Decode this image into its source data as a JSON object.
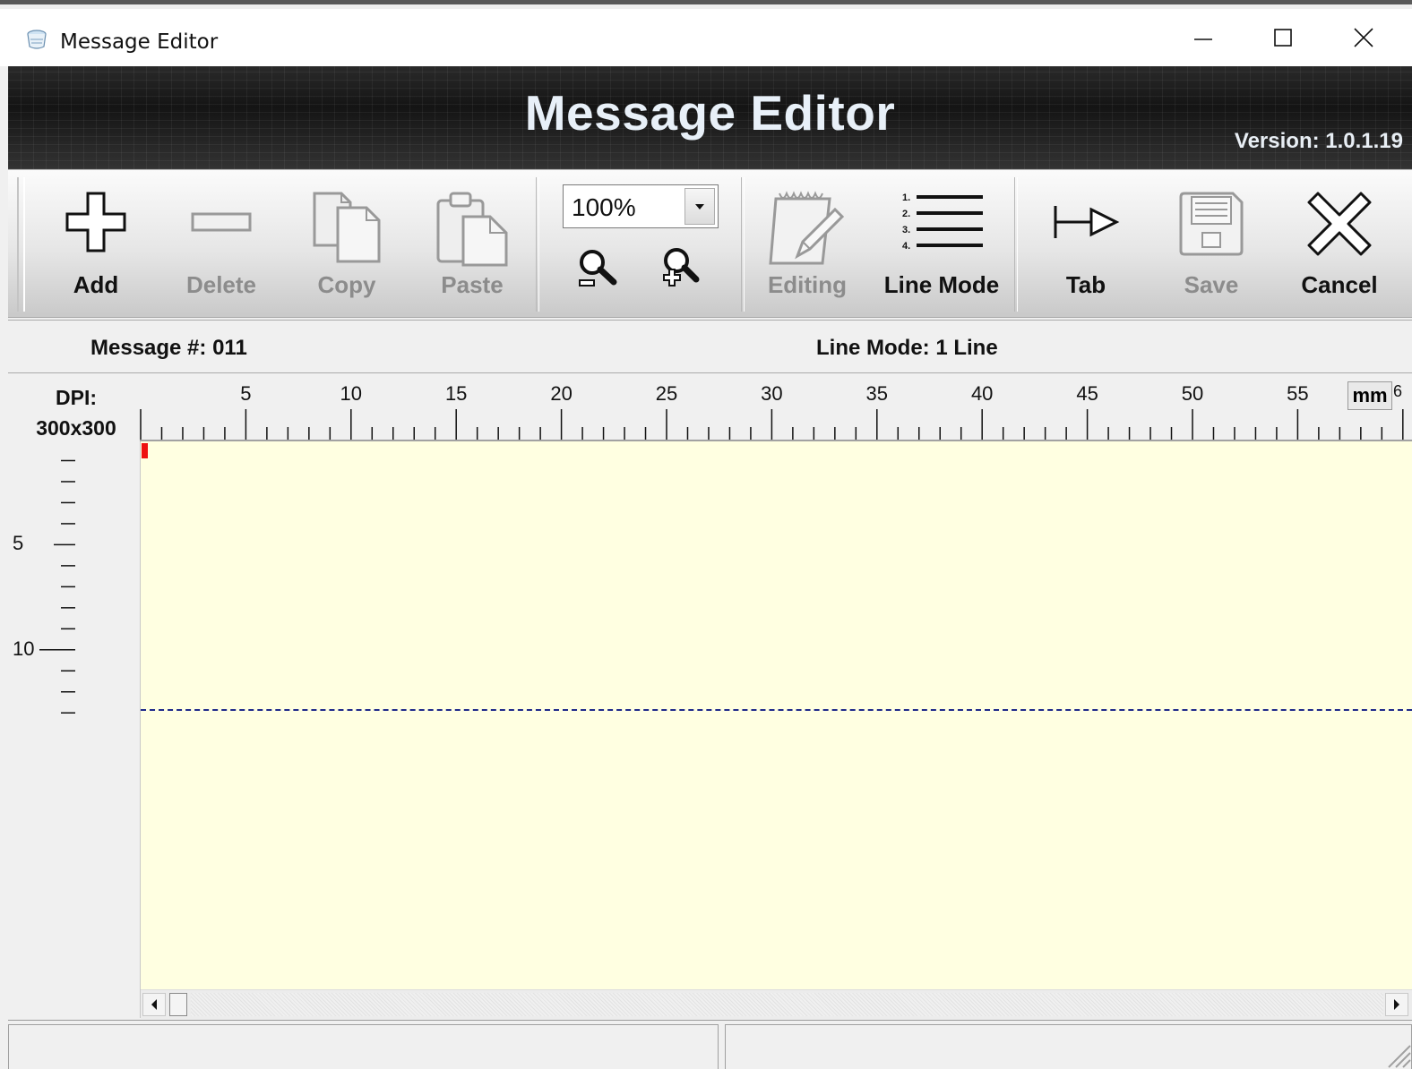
{
  "window": {
    "title": "Message Editor",
    "controls": [
      "minimize",
      "maximize",
      "close"
    ]
  },
  "banner": {
    "heading": "Message Editor",
    "version": "Version: 1.0.1.19"
  },
  "toolbar": {
    "add_label": "Add",
    "delete_label": "Delete",
    "copy_label": "Copy",
    "paste_label": "Paste",
    "zoom_value": "100%",
    "editing_label": "Editing",
    "line_mode_label": "Line Mode",
    "line_mode_icon_numbers": [
      "1.",
      "2.",
      "3.",
      "4."
    ],
    "tab_label": "Tab",
    "save_label": "Save",
    "cancel_label": "Cancel",
    "icons": {
      "add": "plus-icon",
      "delete": "minus-icon",
      "copy": "copy-icon",
      "paste": "paste-icon",
      "zoom_out": "zoom-out-icon",
      "zoom_in": "zoom-in-icon",
      "editing": "notepad-pencil-icon",
      "line_mode": "numbered-list-icon",
      "tab": "tab-arrow-icon",
      "save": "floppy-disk-icon",
      "cancel": "x-icon"
    }
  },
  "info": {
    "message_number": "Message #:  011",
    "line_mode": "Line Mode:  1 Line"
  },
  "ruler": {
    "dpi_label": "DPI:",
    "dpi_value": "300x300",
    "unit": "mm",
    "unit_clipped_digit": "6",
    "horizontal_labels": [
      "5",
      "10",
      "15",
      "20",
      "25",
      "30",
      "35",
      "40",
      "45",
      "50",
      "55"
    ],
    "vertical_labels": [
      "5",
      "10"
    ]
  },
  "colors": {
    "canvas_background": "#ffffe1",
    "cursor": "#ee1111",
    "baseline": "#1f2a8a",
    "banner": "#1e1e1e"
  }
}
